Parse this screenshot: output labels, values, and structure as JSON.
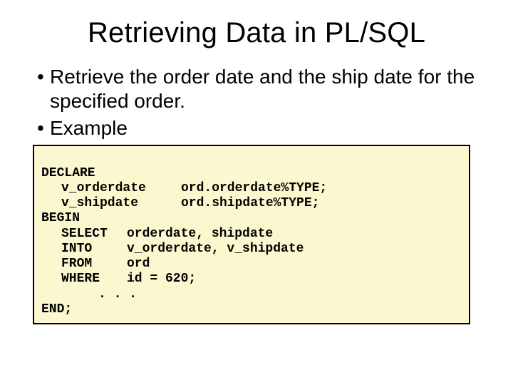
{
  "title": "Retrieving Data in PL/SQL",
  "bullets": [
    "Retrieve the order date and the ship date for the specified order.",
    "Example"
  ],
  "code": {
    "declare_kw": "DECLARE",
    "var1_name": "v_orderdate",
    "var1_type": "ord.orderdate%TYPE;",
    "var2_name": "v_shipdate",
    "var2_type": "ord.shipdate%TYPE;",
    "begin_kw": "BEGIN",
    "select_kw": "SELECT",
    "select_cols": "orderdate, shipdate",
    "into_kw": "INTO",
    "into_vars": "v_orderdate, v_shipdate",
    "from_kw": "FROM",
    "from_tbl": "ord",
    "where_kw": "WHERE",
    "where_cond": "id = 620;",
    "ellipsis": ". . .",
    "end_kw": "END;"
  }
}
